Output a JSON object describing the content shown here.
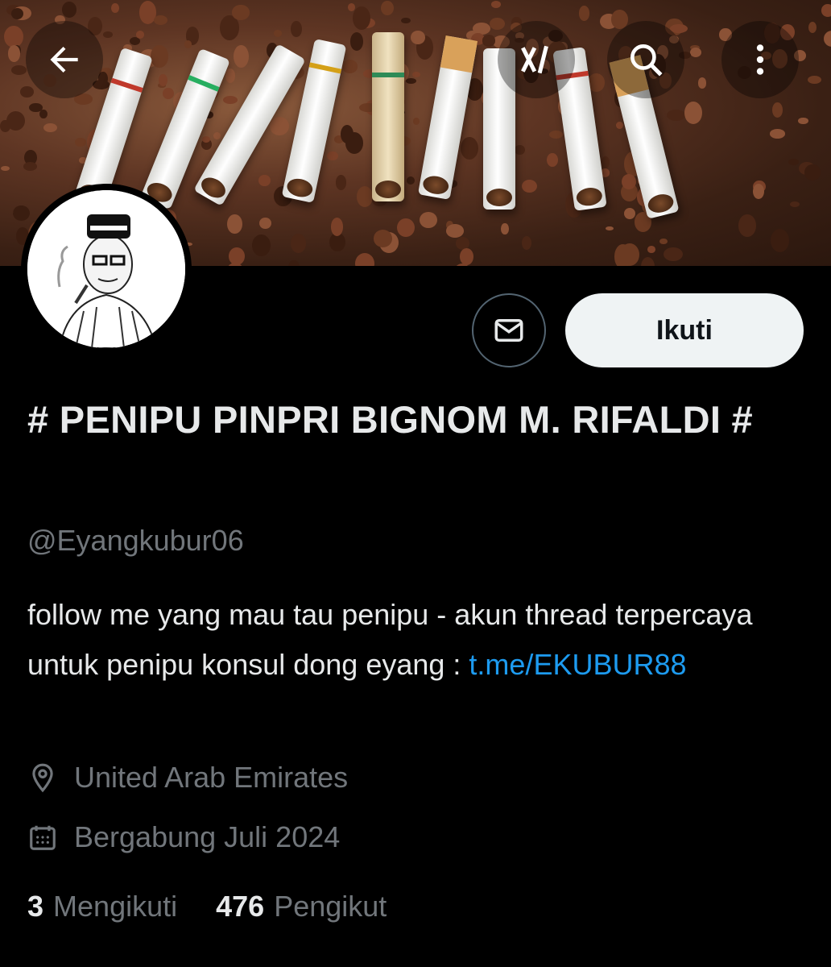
{
  "header": {
    "back_icon": "arrow-left-icon",
    "grok_icon": "grok-icon",
    "search_icon": "search-icon",
    "more_icon": "more-vertical-icon"
  },
  "profile": {
    "display_name": "# PENIPU PINPRI BIGNOM M. RIFALDI #",
    "handle": "@Eyangkubur06",
    "bio_text": "follow me yang mau tau penipu - akun thread terpercaya untuk penipu konsul dong eyang : ",
    "bio_link": "t.me/EKUBUR88",
    "location": "United Arab Emirates",
    "joined": "Bergabung Juli 2024",
    "following_count": "3",
    "following_label": "Mengikuti",
    "followers_count": "476",
    "followers_label": "Pengikut"
  },
  "actions": {
    "follow_label": "Ikuti",
    "message_icon": "envelope-icon"
  },
  "colors": {
    "background": "#000000",
    "text_primary": "#e7e9ea",
    "text_secondary": "#71767b",
    "link": "#1d9bf0",
    "follow_bg": "#eff3f4"
  }
}
